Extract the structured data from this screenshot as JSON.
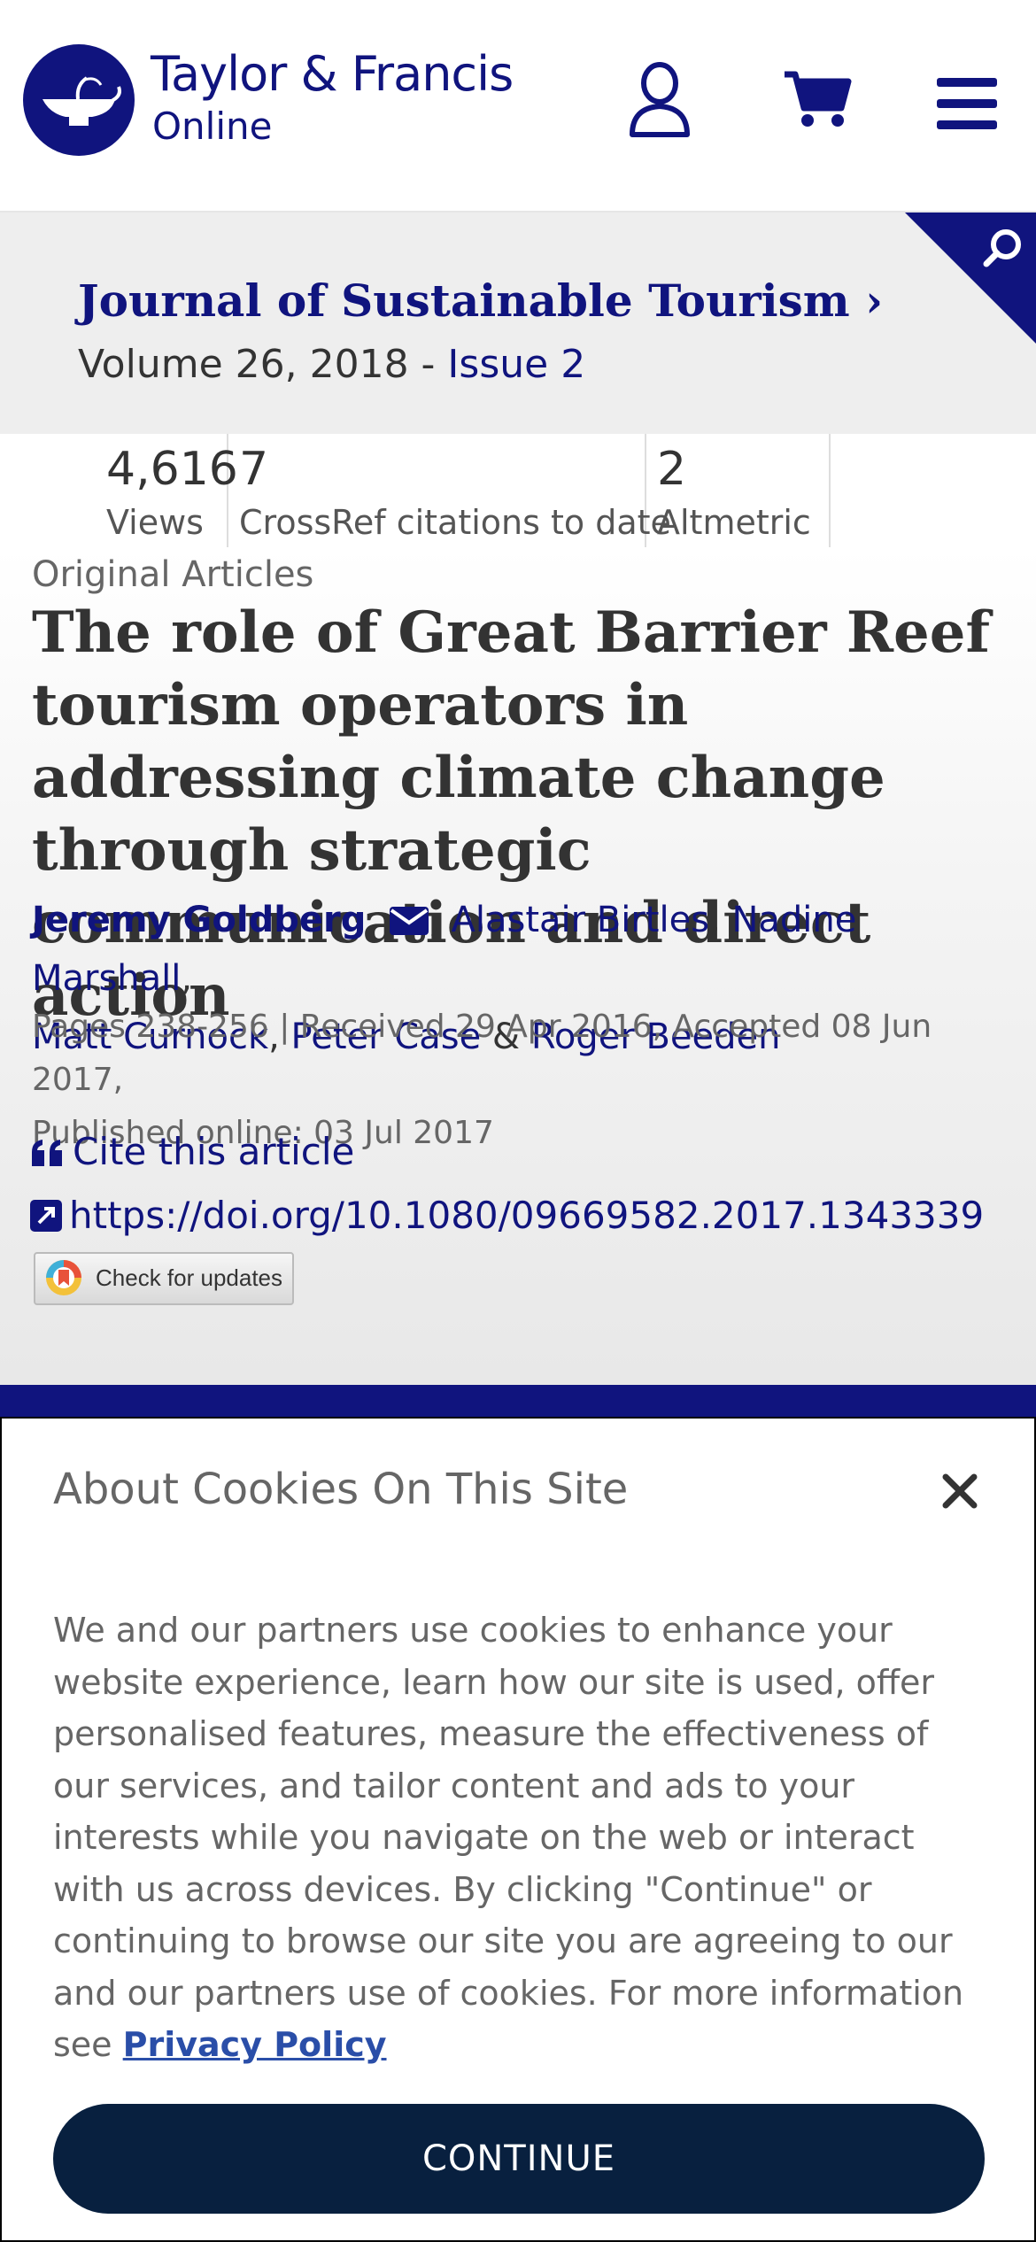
{
  "header": {
    "logo_line1": "Taylor & Francis",
    "logo_line2": "Online",
    "icons": [
      "user-icon",
      "cart-icon",
      "menu-icon"
    ],
    "brand_color": "#10147e"
  },
  "journal": {
    "title": "Journal of Sustainable Tourism",
    "chevron": "›",
    "volume_text": "Volume 26, 2018 - ",
    "issue_text": "Issue 2"
  },
  "metrics": [
    {
      "value": "4,616",
      "label": "Views"
    },
    {
      "value": "7",
      "label": "CrossRef citations to date"
    },
    {
      "value": "2",
      "label": "Altmetric"
    }
  ],
  "article": {
    "type": "Original Articles",
    "title": "The role of Great Barrier Reef tourism operators in addressing climate change through strategic communication and direct action",
    "authors": [
      "Jeremy Goldberg",
      "Alastair Birtles",
      "Nadine Marshall",
      "Matt Curnock",
      "Peter Case",
      "Roger Beeden"
    ],
    "pages": "Pages 238-256",
    "received": "Received 29 Apr 2016, Accepted 08 Jun 2017,",
    "published": "Published online: 03 Jul 2017",
    "cite_label": "Cite this article",
    "doi": "https://doi.org/10.1080/09669582.2017.1343339",
    "updates_label": "Check for updates"
  },
  "cookie": {
    "title": "About Cookies On This Site",
    "text": "We and our partners use cookies to enhance your website experience, learn how our site is used, offer personalised features, measure the effectiveness of our services, and tailor content and ads to your interests while you navigate on the web or interact with us across devices. By clicking \"Continue\" or continuing to browse our site you are agreeing to our and our partners use of cookies. For more information see",
    "policy_link": "Privacy Policy",
    "continue_label": "CONTINUE",
    "button_color": "#08203f"
  }
}
